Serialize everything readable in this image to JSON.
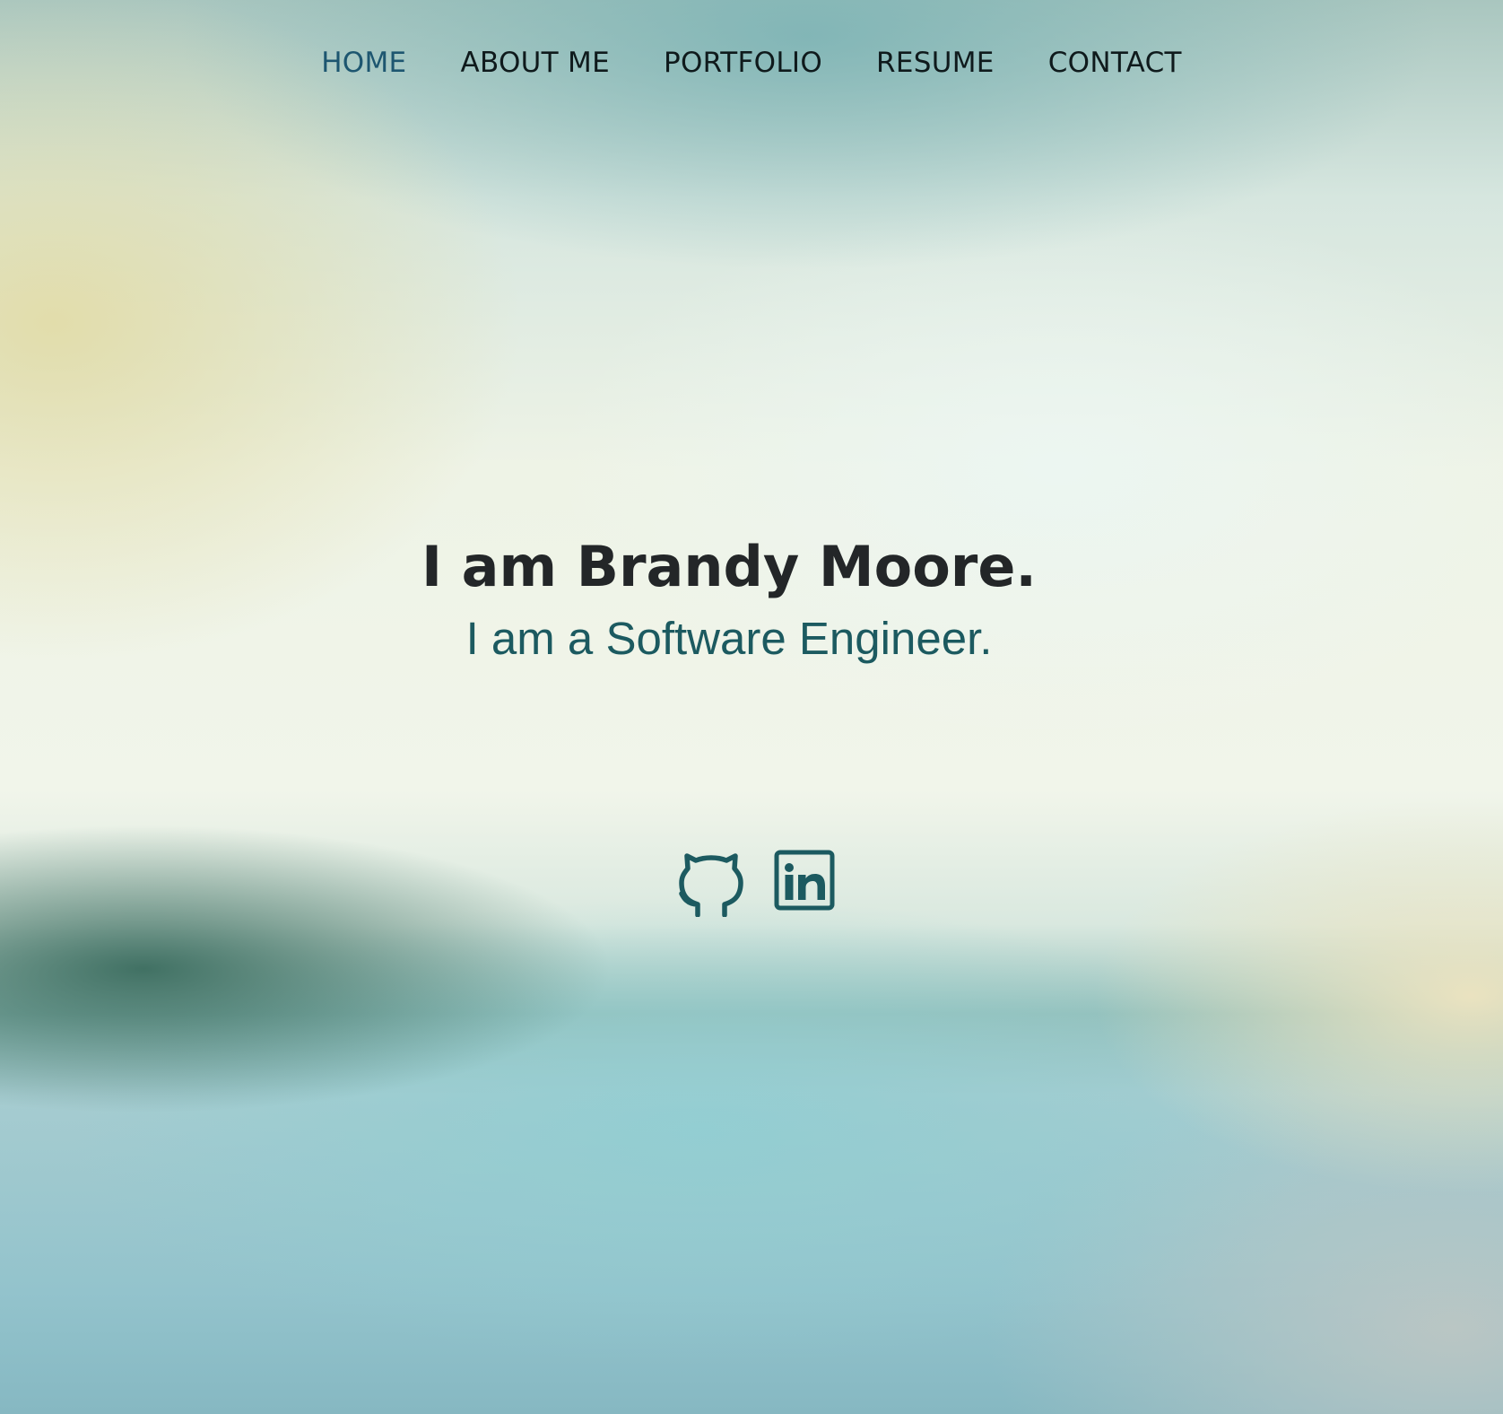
{
  "nav": {
    "items": [
      {
        "label": "HOME",
        "active": true
      },
      {
        "label": "ABOUT ME",
        "active": false
      },
      {
        "label": "PORTFOLIO",
        "active": false
      },
      {
        "label": "RESUME",
        "active": false
      },
      {
        "label": "CONTACT",
        "active": false
      }
    ]
  },
  "hero": {
    "title": "I am Brandy Moore.",
    "subtitle": "I am a Software Engineer."
  },
  "social": {
    "icons": [
      "github-icon",
      "linkedin-icon"
    ]
  },
  "colors": {
    "accent": "#1c5a60",
    "nav_active": "#1d5670",
    "nav_text": "#0f1a1c",
    "title_text": "#232628"
  }
}
